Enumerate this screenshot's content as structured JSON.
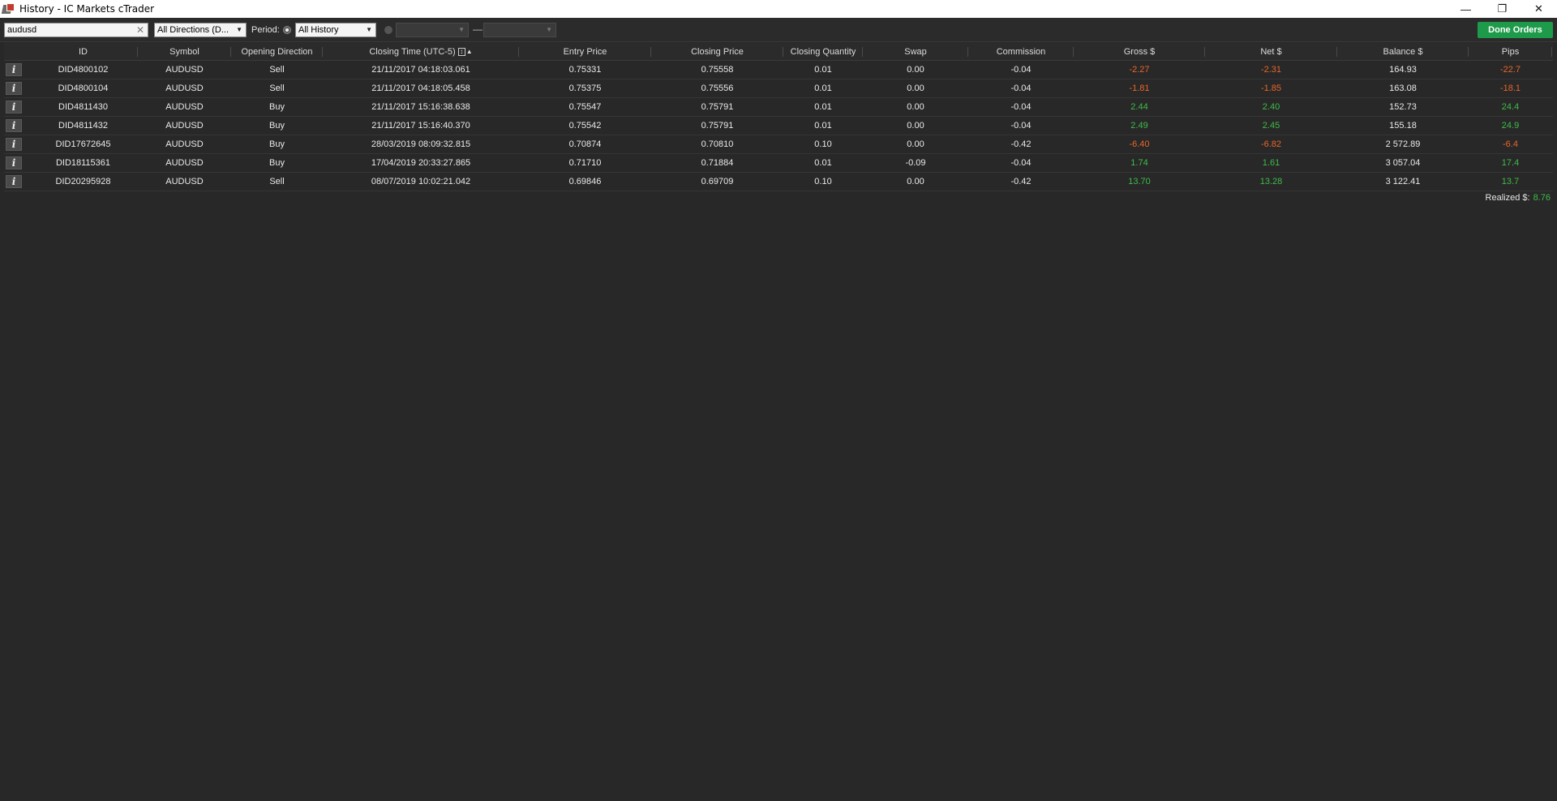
{
  "window": {
    "title": "History - IC Markets cTrader",
    "controls": [
      "minimize",
      "restore",
      "close"
    ]
  },
  "toolbar": {
    "search_value": "audusd",
    "direction_filter": "All Directions (D...",
    "period_label": "Period:",
    "period_value": "All History",
    "date_from": "",
    "date_to": "",
    "date_dash": "—",
    "done_orders_label": "Done Orders"
  },
  "table": {
    "columns": [
      "ID",
      "Symbol",
      "Opening Direction",
      "Closing Time (UTC-5)",
      "Entry Price",
      "Closing Price",
      "Closing Quantity",
      "Swap",
      "Commission",
      "Gross $",
      "Net $",
      "Balance $",
      "Pips"
    ],
    "rows": [
      {
        "id": "DID4800102",
        "symbol": "AUDUSD",
        "direction": "Sell",
        "closing_time": "21/11/2017 04:18:03.061",
        "entry": "0.75331",
        "closing": "0.75558",
        "qty": "0.01",
        "swap": "0.00",
        "commission": "-0.04",
        "gross": "-2.27",
        "net": "-2.31",
        "balance": "164.93",
        "pips": "-22.7"
      },
      {
        "id": "DID4800104",
        "symbol": "AUDUSD",
        "direction": "Sell",
        "closing_time": "21/11/2017 04:18:05.458",
        "entry": "0.75375",
        "closing": "0.75556",
        "qty": "0.01",
        "swap": "0.00",
        "commission": "-0.04",
        "gross": "-1.81",
        "net": "-1.85",
        "balance": "163.08",
        "pips": "-18.1"
      },
      {
        "id": "DID4811430",
        "symbol": "AUDUSD",
        "direction": "Buy",
        "closing_time": "21/11/2017 15:16:38.638",
        "entry": "0.75547",
        "closing": "0.75791",
        "qty": "0.01",
        "swap": "0.00",
        "commission": "-0.04",
        "gross": "2.44",
        "net": "2.40",
        "balance": "152.73",
        "pips": "24.4"
      },
      {
        "id": "DID4811432",
        "symbol": "AUDUSD",
        "direction": "Buy",
        "closing_time": "21/11/2017 15:16:40.370",
        "entry": "0.75542",
        "closing": "0.75791",
        "qty": "0.01",
        "swap": "0.00",
        "commission": "-0.04",
        "gross": "2.49",
        "net": "2.45",
        "balance": "155.18",
        "pips": "24.9"
      },
      {
        "id": "DID17672645",
        "symbol": "AUDUSD",
        "direction": "Buy",
        "closing_time": "28/03/2019 08:09:32.815",
        "entry": "0.70874",
        "closing": "0.70810",
        "qty": "0.10",
        "swap": "0.00",
        "commission": "-0.42",
        "gross": "-6.40",
        "net": "-6.82",
        "balance": "2 572.89",
        "pips": "-6.4"
      },
      {
        "id": "DID18115361",
        "symbol": "AUDUSD",
        "direction": "Buy",
        "closing_time": "17/04/2019 20:33:27.865",
        "entry": "0.71710",
        "closing": "0.71884",
        "qty": "0.01",
        "swap": "-0.09",
        "commission": "-0.04",
        "gross": "1.74",
        "net": "1.61",
        "balance": "3 057.04",
        "pips": "17.4"
      },
      {
        "id": "DID20295928",
        "symbol": "AUDUSD",
        "direction": "Sell",
        "closing_time": "08/07/2019 10:02:21.042",
        "entry": "0.69846",
        "closing": "0.69709",
        "qty": "0.10",
        "swap": "0.00",
        "commission": "-0.42",
        "gross": "13.70",
        "net": "13.28",
        "balance": "3 122.41",
        "pips": "13.7"
      }
    ]
  },
  "summary": {
    "realized_label": "Realized $:",
    "realized_value": "8.76"
  },
  "colors": {
    "negative": "#e8662b",
    "positive": "#3fbb48",
    "accent_button": "#1d9a4a",
    "background": "#282828"
  }
}
